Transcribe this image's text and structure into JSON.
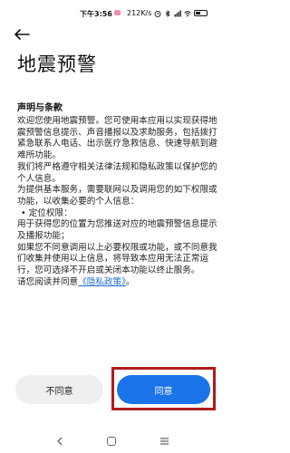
{
  "status_bar": {
    "time": "下午3:56",
    "speed": "212K/s"
  },
  "page": {
    "title": "地震预警"
  },
  "section": {
    "title": "声明与条款",
    "paragraph_1": "欢迎您使用地震预警。您可使用本应用以实现获得地震预警信息提示、声音播报以及求助服务，包括拨打紧急联系人电话、出示医疗急救信息、快速导航到避难所功能。",
    "paragraph_2": "我们将严格遵守相关法律法规和隐私政策以保护您的个人信息。",
    "paragraph_3": "为提供基本服务，需要联网以及调用您的如下权限或功能，以收集必要的个人信息：",
    "bullet_1": "• 定位权限：",
    "paragraph_4": "用于获得您的位置为您推送对应的地震预警信息提示及播报功能；",
    "paragraph_5": "如果您不同意调用以上必要权限或功能，或不同意我们收集并使用以上信息，将导致本应用无法正常运行，您可选择不开启或关闭本功能以终止服务。",
    "read_prefix": "请您阅读并同意",
    "privacy_link": "《隐私政策》",
    "read_suffix": "。"
  },
  "buttons": {
    "disagree": "不同意",
    "agree": "同意"
  },
  "colors": {
    "accent": "#1a73e8",
    "link": "#1a6ad6",
    "highlight_border": "#b01c1c"
  },
  "icons": {
    "back": "arrow-left-icon",
    "nav_back": "chevron-left-icon",
    "nav_home": "square-icon",
    "nav_menu": "hamburger-icon"
  }
}
